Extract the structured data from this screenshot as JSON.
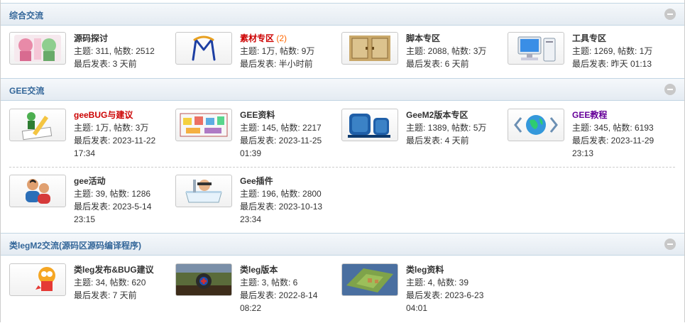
{
  "sections": [
    {
      "title": "综合交流",
      "forums": [
        {
          "name": "源码探讨",
          "today": "",
          "stats": "主题: 311, 帖数: 2512",
          "last": "最后发表: 3 天前",
          "last2": "",
          "icon": "anime-girls-thumbnail"
        },
        {
          "name": "素材专区",
          "today": "(2)",
          "stats": "主题: 1万, 帖数: 9万",
          "last": "最后发表: 半小时前",
          "last2": "",
          "icon": "m-logo-thumbnail"
        },
        {
          "name": "脚本专区",
          "today": "",
          "stats": "主题: 2088, 帖数: 3万",
          "last": "最后发表: 6 天前",
          "last2": "",
          "icon": "cabinet-thumbnail"
        },
        {
          "name": "工具专区",
          "today": "",
          "stats": "主题: 1269, 帖数: 1万",
          "last": "最后发表: 昨天 01:13",
          "last2": "",
          "icon": "computer-thumbnail"
        }
      ]
    },
    {
      "title": "GEE交流",
      "forums": [
        {
          "name": "geeBUG与建议",
          "today": "",
          "stats": "主题: 1万, 帖数: 3万",
          "last": "最后发表: 2023-11-22",
          "last2": "17:34",
          "icon": "pencil-note-thumbnail"
        },
        {
          "name": "GEE资料",
          "today": "",
          "stats": "主题: 145, 帖数: 2217",
          "last": "最后发表: 2023-11-25",
          "last2": "01:39",
          "icon": "board-notes-thumbnail"
        },
        {
          "name": "GeeM2版本专区",
          "today": "",
          "stats": "主题: 1389, 帖数: 5万",
          "last": "最后发表: 4 天前",
          "last2": "",
          "icon": "server-thumbnail"
        },
        {
          "name": "GEE教程",
          "today": "",
          "stats": "主题: 345, 帖数: 6193",
          "last": "最后发表: 2023-11-29",
          "last2": "23:13",
          "icon": "globe-code-thumbnail"
        },
        {
          "name": "gee活动",
          "today": "",
          "stats": "主题: 39, 帖数: 1286",
          "last": "最后发表: 2023-5-14",
          "last2": "23:15",
          "icon": "users-thumbnail"
        },
        {
          "name": "Gee插件",
          "today": "",
          "stats": "主题: 196, 帖数: 2800",
          "last": "最后发表: 2023-10-13",
          "last2": "23:34",
          "icon": "bathtub-thumbnail"
        }
      ]
    },
    {
      "title": "类legM2交流(源码区源码编译程序)",
      "forums": [
        {
          "name": "类leg发布&BUG建议",
          "today": "",
          "stats": "主题: 34, 帖数: 620",
          "last": "最后发表: 7 天前",
          "last2": "",
          "icon": "chat-bubble-thumbnail"
        },
        {
          "name": "类leg版本",
          "today": "",
          "stats": "主题: 3, 帖数: 6",
          "last": "最后发表: 2022-8-14",
          "last2": "08:22",
          "icon": "game-scene-thumbnail"
        },
        {
          "name": "类leg资料",
          "today": "",
          "stats": "主题: 4, 帖数: 39",
          "last": "最后发表: 2023-6-23",
          "last2": "04:01",
          "icon": "game-map-thumbnail"
        }
      ]
    }
  ],
  "colors": {
    "header_text": "#336699",
    "red_name": "#cc0000",
    "purple_name": "#660099",
    "today_count": "#ff6600"
  }
}
